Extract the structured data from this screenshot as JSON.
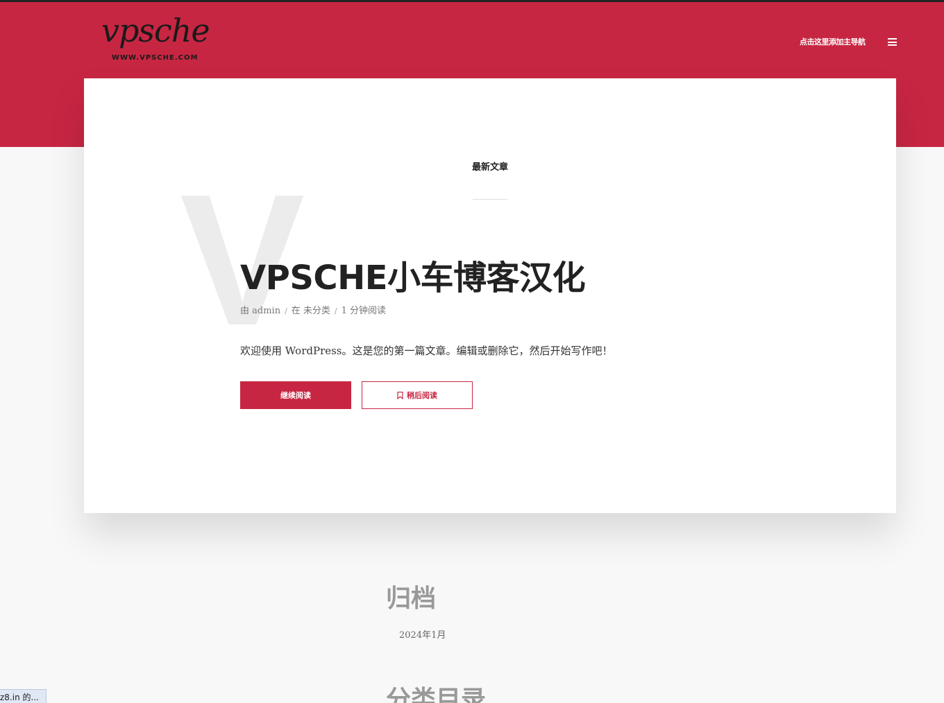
{
  "header": {
    "logo_script": "vpsche",
    "logo_url": "WWW.VPSCHE.COM",
    "nav_link": "点击这里添加主导航",
    "menu_icon": "hamburger-icon",
    "brand_color": "#c72642"
  },
  "featured": {
    "section_label": "最新文章",
    "big_letter": "V",
    "title": "VPSCHE小车博客汉化",
    "meta": {
      "author": "由 admin",
      "category": "在 未分类",
      "read_time": "1 分钟阅读",
      "separator": "/"
    },
    "excerpt": "欢迎使用 WordPress。这是您的第一篇文章。编辑或删除它，然后开始写作吧！",
    "continue_label": "继续阅读",
    "later_label": "稍后阅读",
    "later_icon": "bookmark-icon"
  },
  "archive": {
    "title": "归档",
    "items": [
      "2024年1月"
    ]
  },
  "categories": {
    "title": "分类目录"
  },
  "status_bar": {
    "text": "z8.in 的..."
  }
}
